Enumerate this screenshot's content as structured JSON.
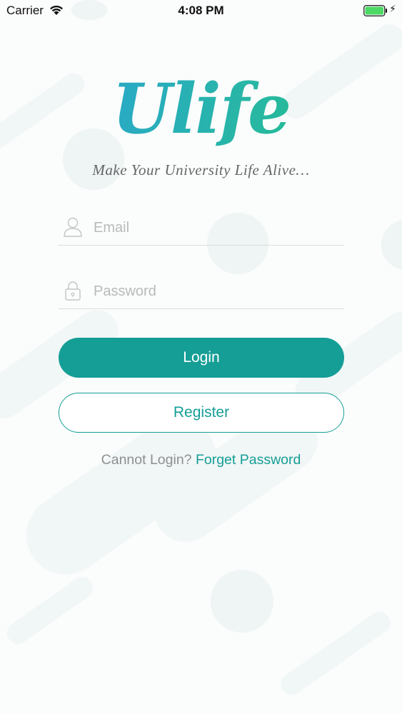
{
  "status_bar": {
    "carrier": "Carrier",
    "time": "4:08 PM",
    "battery_color": "#4cd964"
  },
  "logo": {
    "text": "Ulife",
    "tagline": "Make Your University Life Alive…",
    "gradient_colors": [
      "#2a9fe0",
      "#1fc27c"
    ]
  },
  "form": {
    "email": {
      "placeholder": "Email",
      "value": "",
      "icon": "user-icon"
    },
    "password": {
      "placeholder": "Password",
      "value": "",
      "icon": "lock-icon"
    }
  },
  "buttons": {
    "login_label": "Login",
    "register_label": "Register"
  },
  "help": {
    "prefix": "Cannot Login?",
    "link_text": "Forget Password"
  },
  "colors": {
    "accent": "#149e96",
    "background": "#fbfcfc"
  }
}
